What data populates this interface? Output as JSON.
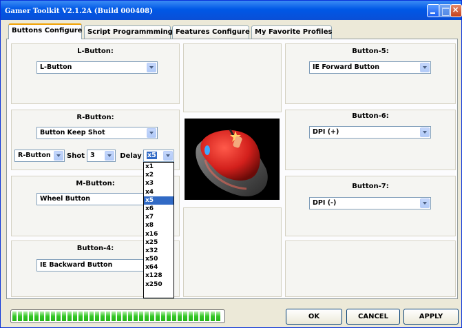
{
  "window": {
    "title": "Gamer Toolkit V2.1.2A (Build 000408)"
  },
  "tabs": [
    {
      "label": "Buttons Configure",
      "active": true
    },
    {
      "label": "Script Programmming",
      "active": false
    },
    {
      "label": "Features Configure",
      "active": false
    },
    {
      "label": "My Favorite Profiles",
      "active": false
    }
  ],
  "l_button": {
    "label": "L-Button:",
    "value": "L-Button"
  },
  "r_button": {
    "label": "R-Button:",
    "value": "Button Keep Shot",
    "sub_select": "R-Button",
    "shot_label": "Shot",
    "shot_value": "3",
    "delay_label": "Delay",
    "delay_value": "x5"
  },
  "delay_options": [
    "x1",
    "x2",
    "x3",
    "x4",
    "x5",
    "x6",
    "x7",
    "x8",
    "x16",
    "x25",
    "x32",
    "x50",
    "x64",
    "x128",
    "x250"
  ],
  "delay_selected_index": 4,
  "m_button": {
    "label": "M-Button:",
    "value": "Wheel Button"
  },
  "button4": {
    "label": "Button-4:",
    "value": "IE Backward Button"
  },
  "button5": {
    "label": "Button-5:",
    "value": "IE Forward Button"
  },
  "button6": {
    "label": "Button-6:",
    "value": "DPI (+)"
  },
  "button7": {
    "label": "Button-7:",
    "value": "DPI (-)"
  },
  "progress": {
    "fraction": 1.0
  },
  "footer": {
    "ok_label": "OK",
    "cancel_label": "CANCEL",
    "apply_label": "APPLY"
  },
  "colors": {
    "titlebar": "#0058e6",
    "selection": "#316ac5",
    "progress": "#34c726",
    "mouse_body": "#d3201c"
  }
}
